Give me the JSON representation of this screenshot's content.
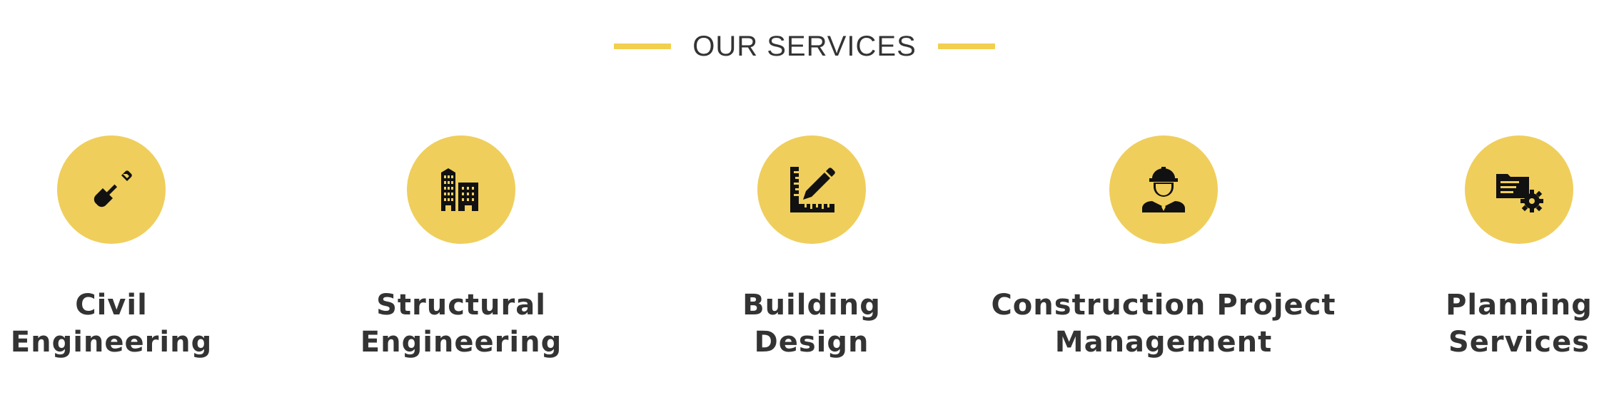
{
  "header": {
    "title": "OUR SERVICES",
    "accent_color": "#f2cf4e"
  },
  "services": [
    {
      "icon": "shovel-icon",
      "line1": "Civil",
      "line2": "Engineering"
    },
    {
      "icon": "buildings-icon",
      "line1": "Structural",
      "line2": "Engineering"
    },
    {
      "icon": "ruler-pencil-icon",
      "line1": "Building",
      "line2": "Design"
    },
    {
      "icon": "engineer-icon",
      "line1": "Construction Project",
      "line2": "Management"
    },
    {
      "icon": "folder-gear-icon",
      "line1": "Planning",
      "line2": "Services"
    }
  ],
  "colors": {
    "circle": "#efce5c",
    "text": "#333333",
    "icon": "#111111"
  }
}
